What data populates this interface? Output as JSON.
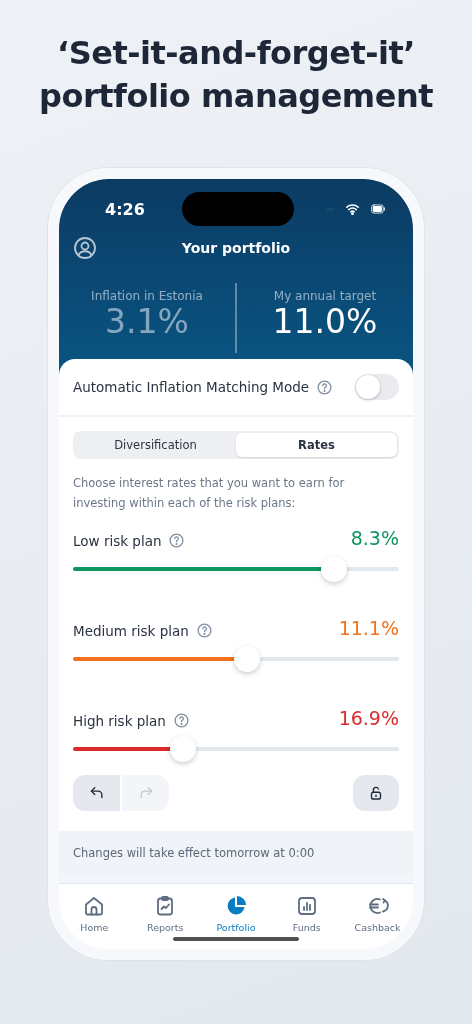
{
  "headline": "‘Set-it-and-forget-it’ portfolio management",
  "status_bar": {
    "time": "4:26"
  },
  "header": {
    "title": "Your portfolio"
  },
  "stats": [
    {
      "label": "Inflation in Estonia",
      "value": "3.1%",
      "muted": true
    },
    {
      "label": "My annual target",
      "value": "11.0%",
      "muted": false
    }
  ],
  "auto_mode": {
    "label": "Automatic Inflation Matching Mode",
    "on": false
  },
  "tabs": [
    {
      "label": "Diversification",
      "selected": false
    },
    {
      "label": "Rates",
      "selected": true
    }
  ],
  "description": "Choose interest rates that you want to earn for investing within each of the risk plans:",
  "plans": [
    {
      "name": "Low risk plan",
      "reading": "8.3%",
      "level": 0.8,
      "color": "#0e9560"
    },
    {
      "name": "Medium risk plan",
      "reading": "11.1%",
      "level": 0.535,
      "color": "#f2711c"
    },
    {
      "name": "High risk plan",
      "reading": "16.9%",
      "level": 0.337,
      "color": "#dc2a2a"
    }
  ],
  "history": {
    "undo_disabled": false,
    "redo_disabled": true
  },
  "notice": "Changes will take effect tomorrow at 0:00",
  "nav": [
    {
      "label": "Home",
      "selected": false
    },
    {
      "label": "Reports",
      "selected": false
    },
    {
      "label": "Portfolio",
      "selected": true
    },
    {
      "label": "Funds",
      "selected": false
    },
    {
      "label": "Cashback",
      "selected": false
    }
  ]
}
